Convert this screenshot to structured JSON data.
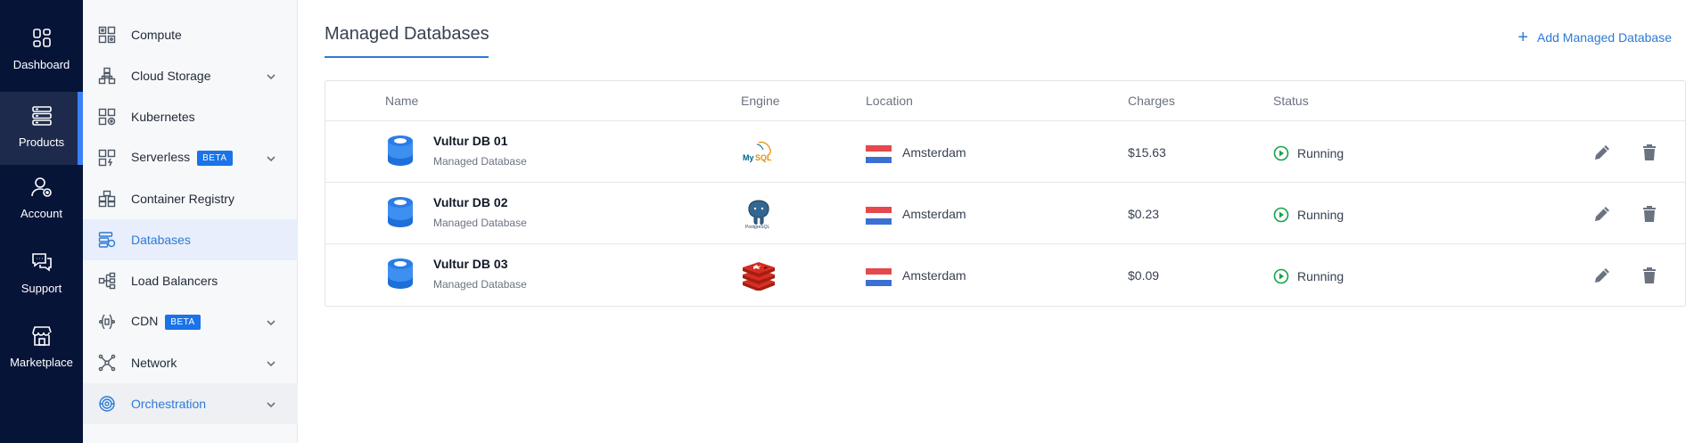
{
  "colors": {
    "rail_bg": "#061438",
    "accent": "#2d7ad6",
    "running": "#16a34a",
    "beta_bg": "#1a73e8"
  },
  "rail": {
    "items": [
      {
        "label": "Dashboard",
        "icon": "dashboard-icon"
      },
      {
        "label": "Products",
        "icon": "products-icon",
        "active": true
      },
      {
        "label": "Account",
        "icon": "account-icon"
      },
      {
        "label": "Support",
        "icon": "support-icon"
      },
      {
        "label": "Marketplace",
        "icon": "marketplace-icon"
      }
    ]
  },
  "subnav": {
    "items": [
      {
        "label": "Compute",
        "icon": "compute-icon"
      },
      {
        "label": "Cloud Storage",
        "icon": "cloud-storage-icon",
        "expandable": true
      },
      {
        "label": "Kubernetes",
        "icon": "kubernetes-icon"
      },
      {
        "label": "Serverless",
        "icon": "serverless-icon",
        "badge": "BETA",
        "expandable": true
      },
      {
        "label": "Container Registry",
        "icon": "container-registry-icon"
      },
      {
        "label": "Databases",
        "icon": "databases-icon",
        "active": true
      },
      {
        "label": "Load Balancers",
        "icon": "load-balancers-icon"
      },
      {
        "label": "CDN",
        "icon": "cdn-icon",
        "badge": "BETA",
        "expandable": true
      },
      {
        "label": "Network",
        "icon": "network-icon",
        "expandable": true
      },
      {
        "label": "Orchestration",
        "icon": "orchestration-icon",
        "expandable": true
      }
    ]
  },
  "header": {
    "title": "Managed Databases",
    "add_label": "Add Managed Database"
  },
  "table": {
    "columns": {
      "name": "Name",
      "engine": "Engine",
      "location": "Location",
      "charges": "Charges",
      "status": "Status"
    },
    "rows": [
      {
        "name": "Vultur DB 01",
        "type": "Managed Database",
        "engine": "MySQL",
        "location": "Amsterdam",
        "charges": "$15.63",
        "status": "Running"
      },
      {
        "name": "Vultur DB 02",
        "type": "Managed Database",
        "engine": "PostgreSQL",
        "location": "Amsterdam",
        "charges": "$0.23",
        "status": "Running"
      },
      {
        "name": "Vultur DB 03",
        "type": "Managed Database",
        "engine": "Redis",
        "location": "Amsterdam",
        "charges": "$0.09",
        "status": "Running"
      }
    ]
  }
}
